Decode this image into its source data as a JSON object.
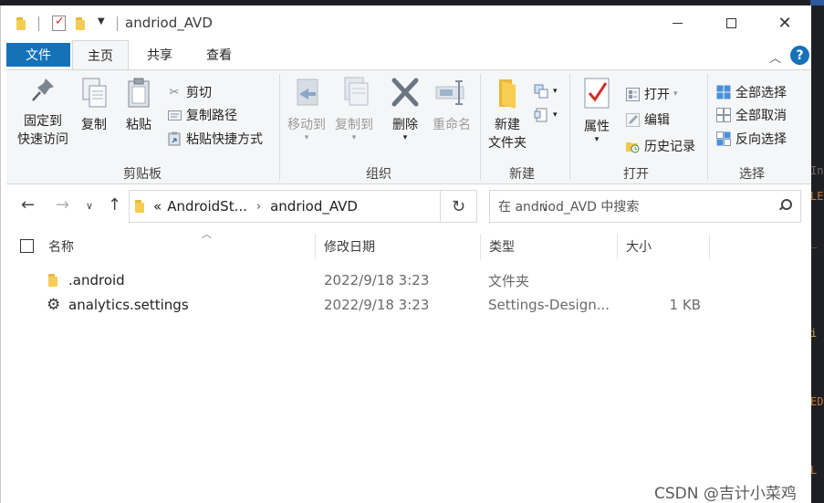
{
  "window": {
    "title": "andriod_AVD"
  },
  "tabs": [
    "文件",
    "主页",
    "共享",
    "查看"
  ],
  "ribbon": {
    "clipboard": {
      "label": "剪贴板",
      "pin": [
        "固定到",
        "快速访问"
      ],
      "copy": "复制",
      "paste": "粘贴",
      "cut": "剪切",
      "copy_path": "复制路径",
      "paste_shortcut": "粘贴快捷方式"
    },
    "organize": {
      "label": "组织",
      "move_to": "移动到",
      "copy_to": "复制到",
      "delete": "删除",
      "rename": "重命名"
    },
    "new": {
      "label": "新建",
      "new_folder": [
        "新建",
        "文件夹"
      ]
    },
    "open": {
      "label": "打开",
      "properties": "属性",
      "open": "打开",
      "edit": "编辑",
      "history": "历史记录"
    },
    "select": {
      "label": "选择",
      "select_all": "全部选择",
      "select_none": "全部取消",
      "invert": "反向选择"
    }
  },
  "address": {
    "prefix": "«",
    "crumbs": [
      "AndroidSt...",
      "andriod_AVD"
    ],
    "search_placeholder": "在 andriod_AVD 中搜索"
  },
  "columns": [
    "名称",
    "修改日期",
    "类型",
    "大小"
  ],
  "files": [
    {
      "name": ".android",
      "date": "2022/9/18 3:23",
      "type": "文件夹",
      "size": "",
      "icon": "folder-icon"
    },
    {
      "name": "analytics.settings",
      "date": "2022/9/18 3:23",
      "type": "Settings-Design...",
      "size": "1 KB",
      "icon": "gear-icon"
    }
  ],
  "watermark": "CSDN @吉计小菜鸡",
  "background_editor_tokens": [
    "In",
    "LE",
    "_",
    "i",
    "ED",
    "L"
  ],
  "colors": {
    "file_tab": "#1672b8",
    "help": "#1672b8",
    "folder": "#f5cd54"
  }
}
